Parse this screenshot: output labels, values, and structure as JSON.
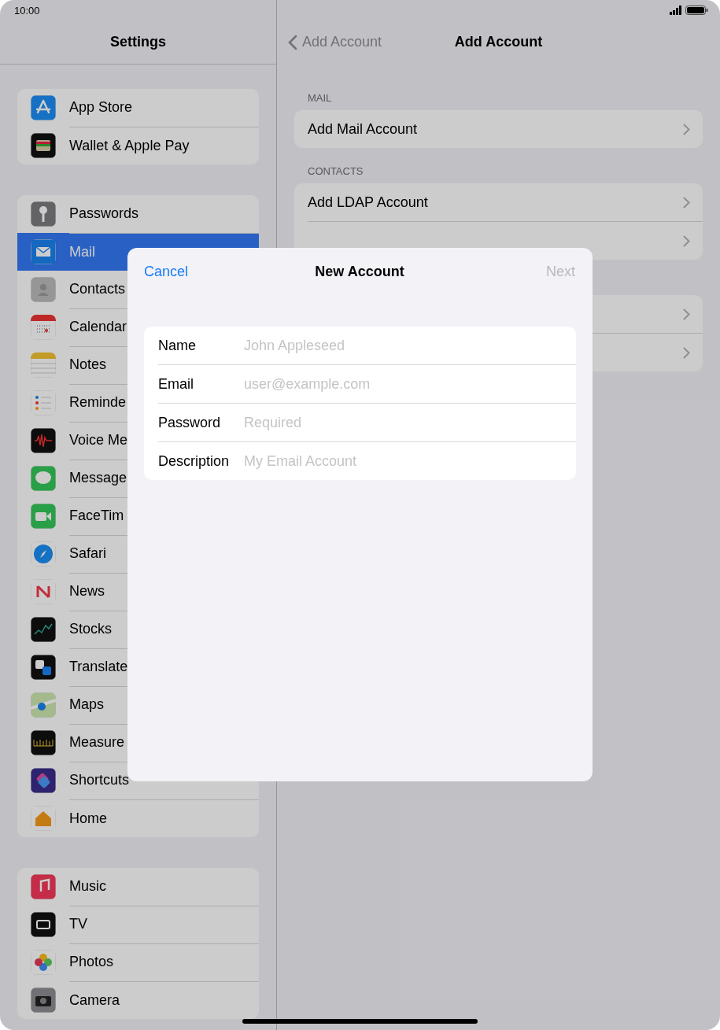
{
  "status_bar": {
    "time": "10:00"
  },
  "sidebar": {
    "title": "Settings",
    "groups": [
      [
        {
          "label": "App Store",
          "selected": false
        },
        {
          "label": "Wallet & Apple Pay",
          "selected": false
        }
      ],
      [
        {
          "label": "Passwords",
          "selected": false
        },
        {
          "label": "Mail",
          "selected": true
        },
        {
          "label": "Contacts",
          "selected": false
        },
        {
          "label": "Calendar",
          "selected": false
        },
        {
          "label": "Notes",
          "selected": false
        },
        {
          "label": "Reminde",
          "selected": false
        },
        {
          "label": "Voice Me",
          "selected": false
        },
        {
          "label": "Message",
          "selected": false
        },
        {
          "label": "FaceTim",
          "selected": false
        },
        {
          "label": "Safari",
          "selected": false
        },
        {
          "label": "News",
          "selected": false
        },
        {
          "label": "Stocks",
          "selected": false
        },
        {
          "label": "Translate",
          "selected": false
        },
        {
          "label": "Maps",
          "selected": false
        },
        {
          "label": "Measure",
          "selected": false
        },
        {
          "label": "Shortcuts",
          "selected": false
        },
        {
          "label": "Home",
          "selected": false
        }
      ],
      [
        {
          "label": "Music",
          "selected": false
        },
        {
          "label": "TV",
          "selected": false
        },
        {
          "label": "Photos",
          "selected": false
        },
        {
          "label": "Camera",
          "selected": false
        }
      ]
    ]
  },
  "detail": {
    "back": "Add Account",
    "title": "Add Account",
    "sections": [
      {
        "header": "MAIL",
        "rows": [
          {
            "kind": "labeled",
            "label": "Add Mail Account"
          }
        ]
      },
      {
        "header": "CONTACTS",
        "rows": [
          {
            "kind": "labeled",
            "label": "Add LDAP Account"
          },
          {
            "kind": "blank"
          }
        ]
      },
      {
        "rows": [
          {
            "kind": "blank"
          },
          {
            "kind": "blank"
          }
        ]
      }
    ]
  },
  "modal": {
    "cancel": "Cancel",
    "title": "New Account",
    "next": {
      "label": "Next",
      "disabled": true
    },
    "fields": [
      {
        "label": "Name",
        "placeholder": "John Appleseed"
      },
      {
        "label": "Email",
        "placeholder": "user@example.com"
      },
      {
        "label": "Password",
        "placeholder": "Required"
      },
      {
        "label": "Description",
        "placeholder": "My Email Account"
      }
    ]
  }
}
